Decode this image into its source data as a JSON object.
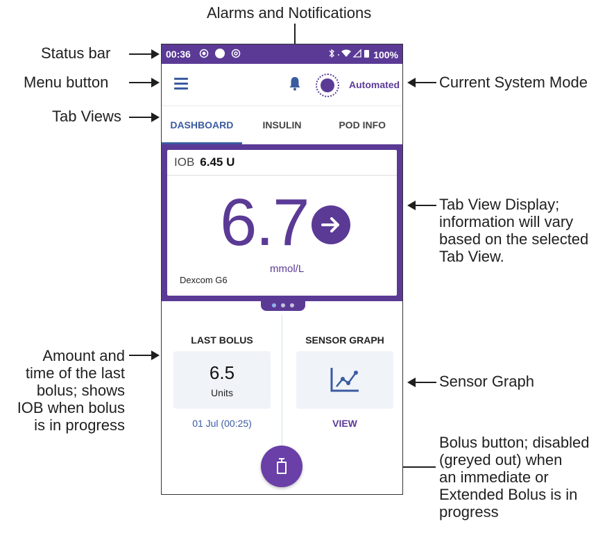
{
  "callouts": {
    "alarms": "Alarms and Notifications",
    "status_bar": "Status bar",
    "menu_button": "Menu button",
    "tab_views": "Tab Views",
    "system_mode": "Current System Mode",
    "tab_view_display": [
      "Tab View Display;",
      "information will vary",
      "based on the selected",
      "Tab View."
    ],
    "last_bolus": [
      "Amount and",
      "time of the last",
      "bolus; shows",
      "IOB when bolus",
      "is in progress"
    ],
    "sensor_graph": "Sensor Graph",
    "bolus_button": [
      "Bolus button; disabled",
      "(greyed out) when",
      "an immediate or",
      "Extended Bolus is in",
      "progress"
    ]
  },
  "phone": {
    "status": {
      "time": "00:36",
      "battery": "100%"
    },
    "mode": "Automated",
    "tabs": [
      "DASHBOARD",
      "INSULIN",
      "POD INFO"
    ],
    "active_tab": "DASHBOARD",
    "iob": {
      "label": "IOB",
      "value": "6.45 U"
    },
    "glucose": {
      "value": "6.7",
      "unit": "mmol/L",
      "source": "Dexcom G6"
    },
    "last_bolus": {
      "title": "LAST BOLUS",
      "amount": "6.5",
      "unit": "Units",
      "time": "01 Jul (00:25)"
    },
    "sensor_graph": {
      "title": "SENSOR GRAPH",
      "link": "VIEW"
    }
  },
  "colors": {
    "brand_purple": "#5b3a96",
    "accent_blue": "#3a5ba0"
  }
}
